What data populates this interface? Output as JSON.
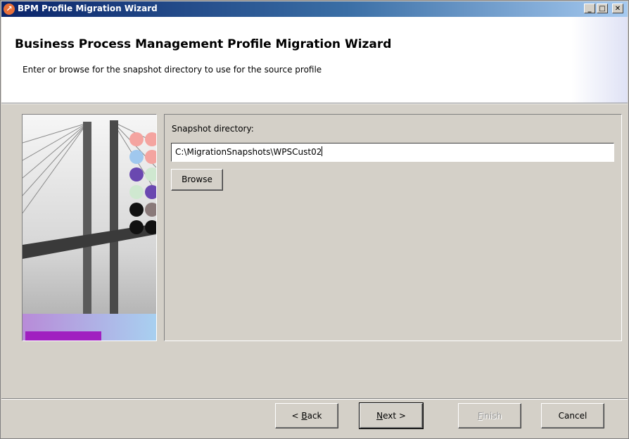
{
  "window": {
    "title": "BPM Profile Migration Wizard",
    "app_icon": "wizard-app-icon",
    "controls": {
      "minimize": "_",
      "maximize": "□",
      "close": "✕"
    }
  },
  "header": {
    "title": "Business Process Management Profile Migration Wizard",
    "description": "Enter or browse for the snapshot directory to use for the source profile"
  },
  "form": {
    "snapshot_label": "Snapshot directory:",
    "snapshot_value": "C:\\MigrationSnapshots\\WPSCust02",
    "browse_label": "Browse"
  },
  "footer": {
    "back": {
      "pre": "< ",
      "mnemonic": "B",
      "rest": "ack",
      "enabled": true
    },
    "next": {
      "mnemonic": "N",
      "rest": "ext >",
      "enabled": true
    },
    "finish": {
      "mnemonic": "F",
      "rest": "inish",
      "enabled": false
    },
    "cancel": {
      "label": "Cancel",
      "enabled": true
    }
  },
  "colors": {
    "titlebar_start": "#0a246a",
    "titlebar_end": "#a6caf0",
    "dialog_bg": "#d4d0c8",
    "banner_magenta": "#a020c0"
  }
}
